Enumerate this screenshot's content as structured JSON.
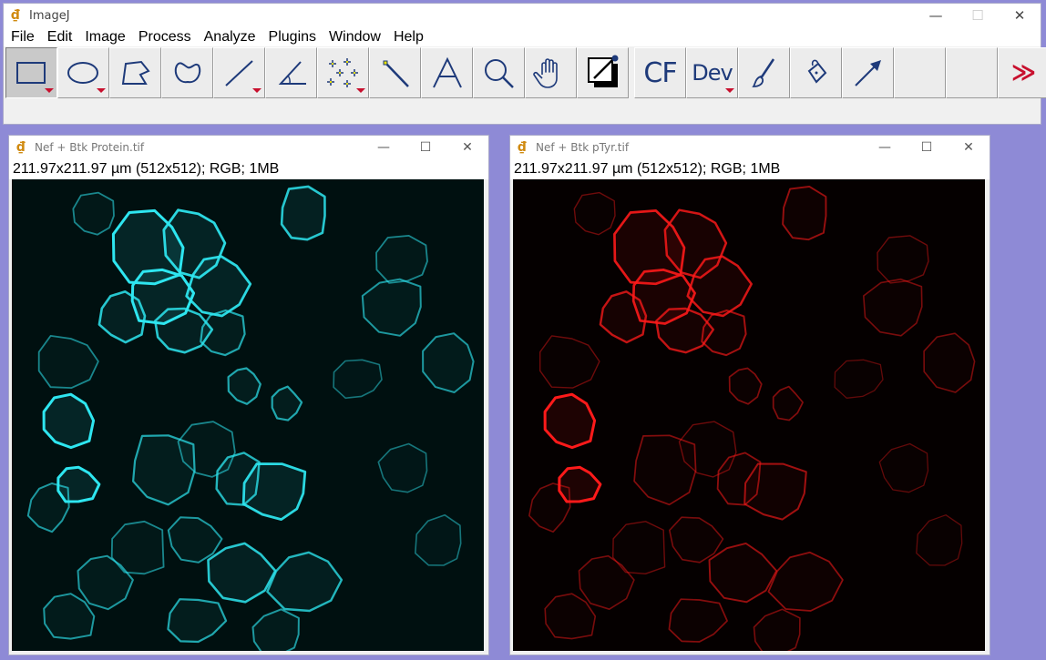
{
  "main_window": {
    "title": "ImageJ",
    "controls": {
      "minimize": "—",
      "maximize": "☐",
      "close": "✕"
    },
    "menu": [
      "File",
      "Edit",
      "Image",
      "Process",
      "Analyze",
      "Plugins",
      "Window",
      "Help"
    ],
    "toolbar": {
      "tools": [
        {
          "name": "rectangle-tool",
          "selected": true
        },
        {
          "name": "oval-tool"
        },
        {
          "name": "polygon-tool"
        },
        {
          "name": "freehand-tool"
        },
        {
          "name": "line-tool"
        },
        {
          "name": "angle-tool"
        },
        {
          "name": "multipoint-tool"
        },
        {
          "name": "wand-tool"
        },
        {
          "name": "text-tool"
        },
        {
          "name": "magnifier-tool"
        },
        {
          "name": "hand-tool"
        },
        {
          "name": "color-picker-tool"
        }
      ],
      "cf_label": "CF",
      "dev_label": "Dev",
      "more_label": "≫"
    }
  },
  "image_windows": [
    {
      "title": "Nef + Btk Protein.tif",
      "info": "211.97x211.97 µm (512x512); RGB; 1MB",
      "channel_color": "#2ee6f0"
    },
    {
      "title": "Nef + Btk pTyr.tif",
      "info": "211.97x211.97 µm (512x512); RGB; 1MB",
      "channel_color": "#ff1a1a"
    }
  ],
  "colors": {
    "desktop": "#8e8ad6",
    "accent_red": "#c8102e",
    "icon_blue": "#1e3a7a"
  }
}
